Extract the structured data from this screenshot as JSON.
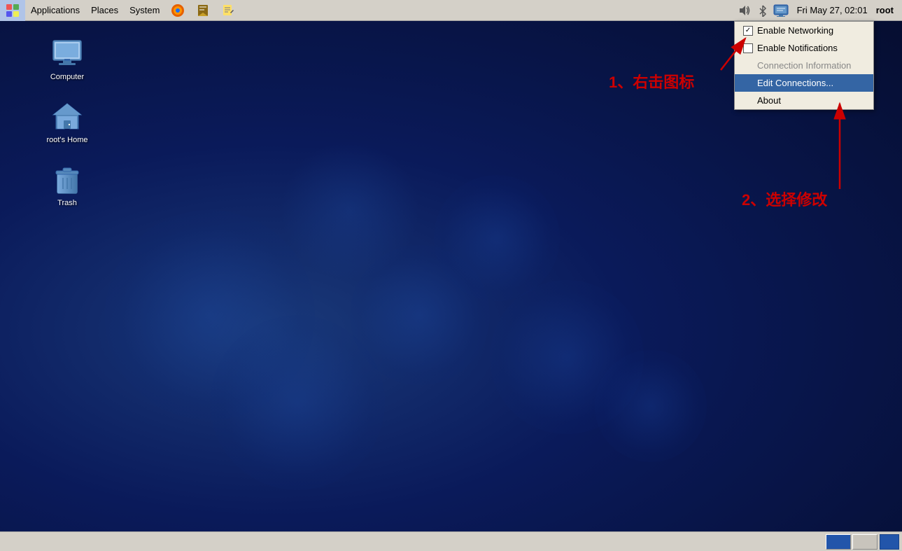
{
  "taskbar": {
    "menus": [
      "Applications",
      "Places",
      "System"
    ],
    "clock": "Fri May 27, 02:01",
    "user": "root"
  },
  "desktop": {
    "icons": [
      {
        "id": "computer",
        "label": "Computer"
      },
      {
        "id": "home",
        "label": "root's Home"
      },
      {
        "id": "trash",
        "label": "Trash"
      }
    ]
  },
  "context_menu": {
    "items": [
      {
        "id": "enable-networking",
        "label": "Enable Networking",
        "type": "checkbox",
        "checked": true
      },
      {
        "id": "enable-notifications",
        "label": "Enable Notifications",
        "type": "checkbox",
        "checked": false
      },
      {
        "id": "connection-information",
        "label": "Connection Information",
        "type": "item",
        "disabled": true
      },
      {
        "id": "edit-connections",
        "label": "Edit Connections...",
        "type": "item",
        "highlighted": true
      },
      {
        "id": "about",
        "label": "About",
        "type": "item"
      }
    ]
  },
  "annotations": {
    "right_click": "1、右击图标",
    "select_modify": "2、选择修改"
  }
}
